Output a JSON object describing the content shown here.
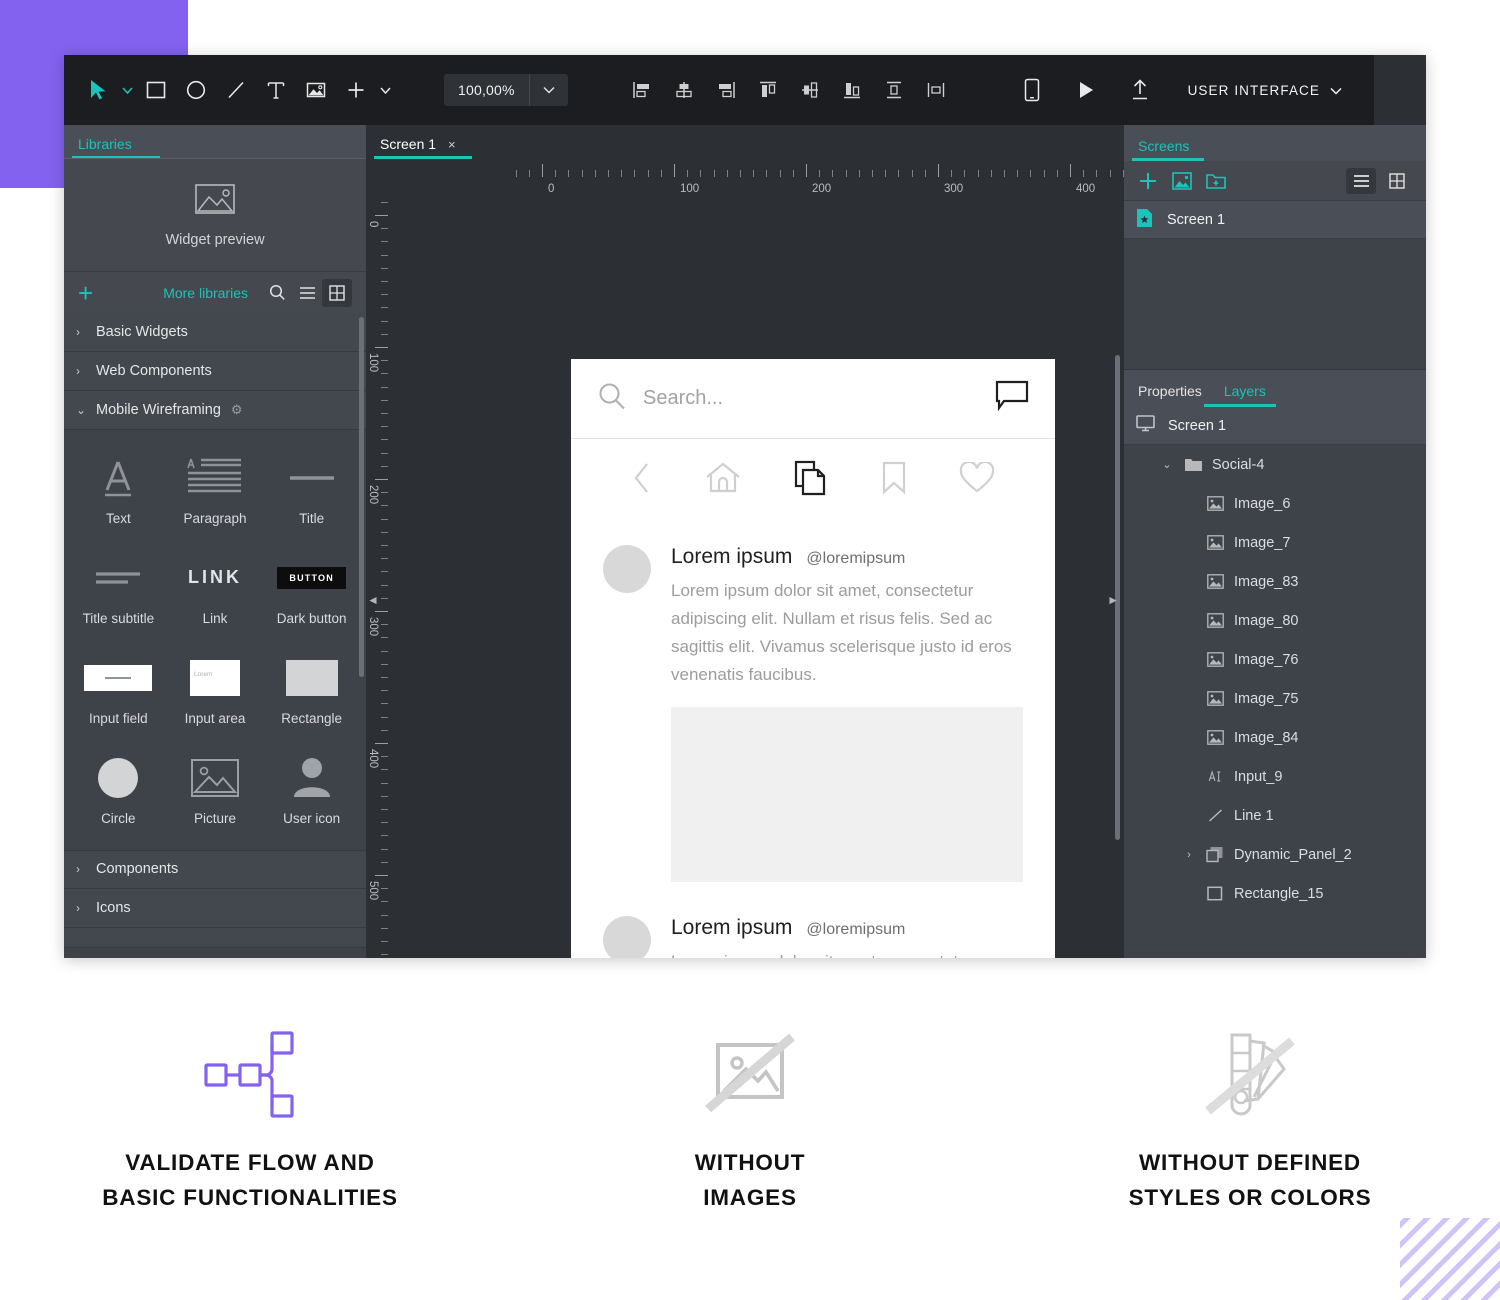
{
  "toolbar": {
    "tools": [
      {
        "name": "pointer-tool",
        "icon": "pointer"
      },
      {
        "name": "rectangle-tool",
        "icon": "square"
      },
      {
        "name": "ellipse-tool",
        "icon": "circle"
      },
      {
        "name": "line-tool",
        "icon": "line"
      },
      {
        "name": "text-tool",
        "icon": "text-T"
      },
      {
        "name": "image-tool",
        "icon": "image"
      },
      {
        "name": "add-tool",
        "icon": "plus"
      }
    ],
    "zoom_value": "100,00%",
    "align_tools": [
      "align-left",
      "align-center-horizontal",
      "align-right",
      "align-top",
      "align-middle-vertical",
      "align-bottom",
      "distribute-vertical",
      "distribute-horizontal"
    ],
    "preview_tools": [
      "device-preview",
      "play-preview",
      "publish-upload"
    ],
    "mode_label": "USER INTERFACE"
  },
  "left_panel": {
    "tab_label": "Libraries",
    "widget_preview_label": "Widget preview",
    "more_libraries_label": "More libraries",
    "add_label": "+",
    "categories": [
      {
        "label": "Basic Widgets",
        "expanded": false,
        "gear": false
      },
      {
        "label": "Web Components",
        "expanded": false,
        "gear": false
      },
      {
        "label": "Mobile Wireframing",
        "expanded": true,
        "gear": true
      }
    ],
    "widgets": [
      {
        "label": "Text",
        "art": "letter-a"
      },
      {
        "label": "Paragraph",
        "art": "paragraph"
      },
      {
        "label": "Title",
        "art": "title-line"
      },
      {
        "label": "Title subtitle",
        "art": "title-subtitle"
      },
      {
        "label": "Link",
        "art": "link-text",
        "text": "LINK"
      },
      {
        "label": "Dark button",
        "art": "dark-button",
        "text": "BUTTON"
      },
      {
        "label": "Input field",
        "art": "input-field"
      },
      {
        "label": "Input area",
        "art": "input-area",
        "text": "Lorem"
      },
      {
        "label": "Rectangle",
        "art": "rectangle"
      },
      {
        "label": "Circle",
        "art": "circle"
      },
      {
        "label": "Picture",
        "art": "picture"
      },
      {
        "label": "User icon",
        "art": "user"
      }
    ],
    "footer_categories": [
      {
        "label": "Components"
      },
      {
        "label": "Icons"
      }
    ]
  },
  "canvas": {
    "tab_label": "Screen 1",
    "close_label": "×",
    "ruler_h_labels": [
      "0",
      "100",
      "200",
      "300",
      "400"
    ],
    "ruler_v_labels": [
      "0",
      "100",
      "200",
      "300",
      "400",
      "500"
    ]
  },
  "mockup": {
    "search_placeholder": "Search...",
    "nav_icons": [
      "back-chevron",
      "home",
      "pages",
      "bookmark",
      "heart"
    ],
    "posts": [
      {
        "name": "Lorem ipsum",
        "handle": "@loremipsum",
        "text": "Lorem ipsum dolor sit amet, consectetur adipiscing elit. Nullam et risus felis. Sed ac sagittis elit. Vivamus scelerisque justo id eros venenatis faucibus.",
        "has_image": true
      },
      {
        "name": "Lorem ipsum",
        "handle": "@loremipsum",
        "text": "Lorem ipsum dolor sit amet, consectetur adipiscing elit. Nullam et risus felis. Sed ac",
        "has_image": false
      }
    ]
  },
  "right_panel": {
    "screens_tab_label": "Screens",
    "screens_actions": [
      "add-screen",
      "add-image-screen",
      "add-folder"
    ],
    "screens": [
      {
        "label": "Screen 1"
      }
    ],
    "properties_tab_label": "Properties",
    "layers_tab_label": "Layers",
    "layers_root": "Screen 1",
    "layers": [
      {
        "label": "Social-4",
        "icon": "folder",
        "indent": 1,
        "expandable": true,
        "expanded": true
      },
      {
        "label": "Image_6",
        "icon": "image",
        "indent": 2,
        "expandable": false
      },
      {
        "label": "Image_7",
        "icon": "image",
        "indent": 2,
        "expandable": false
      },
      {
        "label": "Image_83",
        "icon": "image",
        "indent": 2,
        "expandable": false
      },
      {
        "label": "Image_80",
        "icon": "image",
        "indent": 2,
        "expandable": false
      },
      {
        "label": "Image_76",
        "icon": "image",
        "indent": 2,
        "expandable": false
      },
      {
        "label": "Image_75",
        "icon": "image",
        "indent": 2,
        "expandable": false
      },
      {
        "label": "Image_84",
        "icon": "image",
        "indent": 2,
        "expandable": false
      },
      {
        "label": "Input_9",
        "icon": "text-ai",
        "indent": 2,
        "expandable": false
      },
      {
        "label": "Line 1",
        "icon": "line",
        "indent": 2,
        "expandable": false
      },
      {
        "label": "Dynamic_Panel_2",
        "icon": "panel",
        "indent": 2,
        "expandable": true,
        "expanded": false
      },
      {
        "label": "Rectangle_15",
        "icon": "square",
        "indent": 2,
        "expandable": false
      }
    ]
  },
  "features": [
    {
      "icon": "flow-diagram-icon",
      "color": "#8362f0",
      "lines": [
        "VALIDATE FLOW AND",
        "BASIC FUNCTIONALITIES"
      ]
    },
    {
      "icon": "no-images-icon",
      "color": "#c4c4c4",
      "lines": [
        "WITHOUT",
        "IMAGES"
      ]
    },
    {
      "icon": "no-styles-icon",
      "color": "#c4c4c4",
      "lines": [
        "WITHOUT DEFINED",
        "STYLES OR COLORS"
      ]
    }
  ],
  "colors": {
    "accent_teal": "#19c4bd",
    "accent_purple": "#8362f0",
    "toolbar_bg": "#1c1d20",
    "panel_bg": "#3e4249",
    "canvas_bg": "#2c2f34"
  }
}
